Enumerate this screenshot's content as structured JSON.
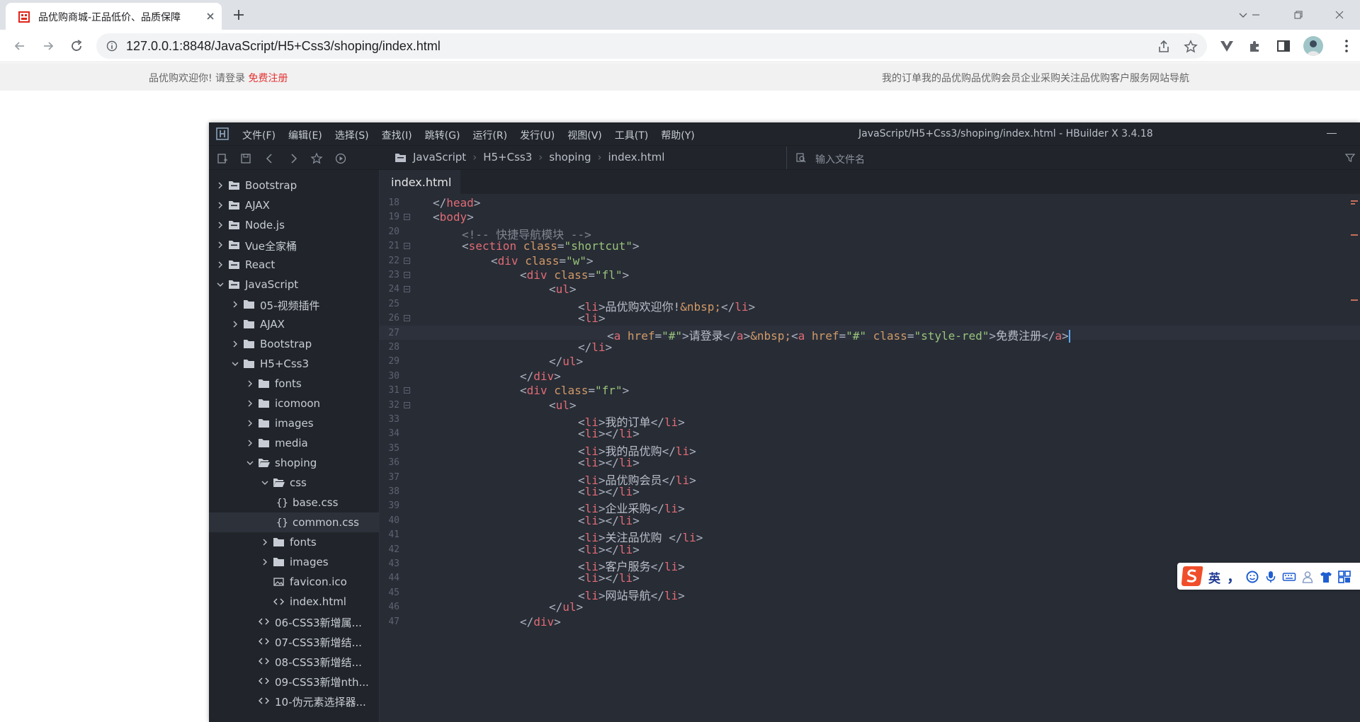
{
  "browser": {
    "tab_title": "品优购商城-正品低价、品质保障",
    "url": "127.0.0.1:8848/JavaScript/H5+Css3/shoping/index.html"
  },
  "page": {
    "shortcut_welcome": "品优购欢迎你! 请登录 ",
    "shortcut_register": "免费注册",
    "shortcut_right": "我的订单我的品优购品优购会员企业采购关注品优购客户服务网站导航"
  },
  "ide": {
    "menu": [
      "文件(F)",
      "编辑(E)",
      "选择(S)",
      "查找(I)",
      "跳转(G)",
      "运行(R)",
      "发行(U)",
      "视图(V)",
      "工具(T)",
      "帮助(Y)"
    ],
    "window_title": "JavaScript/H5+Css3/shoping/index.html - HBuilder X 3.4.18",
    "breadcrumbs": [
      "JavaScript",
      "H5+Css3",
      "shoping",
      "index.html"
    ],
    "file_search_placeholder": "输入文件名",
    "editor_tab": "index.html",
    "tree": [
      {
        "label": "Bootstrap",
        "depth": 0,
        "type": "project",
        "state": "collapsed"
      },
      {
        "label": "AJAX",
        "depth": 0,
        "type": "project",
        "state": "collapsed"
      },
      {
        "label": "Node.js",
        "depth": 0,
        "type": "project",
        "state": "collapsed"
      },
      {
        "label": "Vue全家桶",
        "depth": 0,
        "type": "project",
        "state": "collapsed"
      },
      {
        "label": "React",
        "depth": 0,
        "type": "project",
        "state": "collapsed"
      },
      {
        "label": "JavaScript",
        "depth": 0,
        "type": "project",
        "state": "expanded"
      },
      {
        "label": "05-视频插件",
        "depth": 1,
        "type": "folder",
        "state": "collapsed"
      },
      {
        "label": "AJAX",
        "depth": 1,
        "type": "folder",
        "state": "collapsed"
      },
      {
        "label": "Bootstrap",
        "depth": 1,
        "type": "folder",
        "state": "collapsed"
      },
      {
        "label": "H5+Css3",
        "depth": 1,
        "type": "folder",
        "state": "expanded"
      },
      {
        "label": "fonts",
        "depth": 2,
        "type": "folder",
        "state": "collapsed"
      },
      {
        "label": "icomoon",
        "depth": 2,
        "type": "folder",
        "state": "collapsed"
      },
      {
        "label": "images",
        "depth": 2,
        "type": "folder",
        "state": "collapsed"
      },
      {
        "label": "media",
        "depth": 2,
        "type": "folder",
        "state": "collapsed"
      },
      {
        "label": "shoping",
        "depth": 2,
        "type": "folder-open",
        "state": "expanded"
      },
      {
        "label": "css",
        "depth": 3,
        "type": "folder-open",
        "state": "expanded"
      },
      {
        "label": "base.css",
        "depth": 4,
        "type": "css",
        "state": "none"
      },
      {
        "label": "common.css",
        "depth": 4,
        "type": "css",
        "state": "none",
        "selected": true
      },
      {
        "label": "fonts",
        "depth": 3,
        "type": "folder",
        "state": "collapsed"
      },
      {
        "label": "images",
        "depth": 3,
        "type": "folder",
        "state": "collapsed"
      },
      {
        "label": "favicon.ico",
        "depth": 3,
        "type": "image",
        "state": "none"
      },
      {
        "label": "index.html",
        "depth": 3,
        "type": "html",
        "state": "none"
      },
      {
        "label": "06-CSS3新增属...",
        "depth": 2,
        "type": "html",
        "state": "none"
      },
      {
        "label": "07-CSS3新增结...",
        "depth": 2,
        "type": "html",
        "state": "none"
      },
      {
        "label": "08-CSS3新增结...",
        "depth": 2,
        "type": "html",
        "state": "none"
      },
      {
        "label": "09-CSS3新增nth...",
        "depth": 2,
        "type": "html",
        "state": "none"
      },
      {
        "label": "10-伪元素选择器...",
        "depth": 2,
        "type": "html",
        "state": "none"
      }
    ],
    "code_lines": [
      {
        "n": "18",
        "fold": false,
        "indent": 1,
        "tokens": [
          [
            "p",
            "</"
          ],
          [
            "t",
            "head"
          ],
          [
            "p",
            ">"
          ]
        ]
      },
      {
        "n": "19",
        "fold": true,
        "indent": 1,
        "tokens": [
          [
            "p",
            "<"
          ],
          [
            "t",
            "body"
          ],
          [
            "p",
            ">"
          ]
        ]
      },
      {
        "n": "20",
        "fold": false,
        "indent": 2,
        "tokens": [
          [
            "c",
            "<!-- 快捷导航模块 -->"
          ]
        ]
      },
      {
        "n": "21",
        "fold": true,
        "indent": 2,
        "tokens": [
          [
            "p",
            "<"
          ],
          [
            "t",
            "section"
          ],
          [
            "p",
            " "
          ],
          [
            "a",
            "class"
          ],
          [
            "p",
            "="
          ],
          [
            "s",
            "\"shortcut\""
          ],
          [
            "p",
            ">"
          ]
        ]
      },
      {
        "n": "22",
        "fold": true,
        "indent": 3,
        "tokens": [
          [
            "p",
            "<"
          ],
          [
            "t",
            "div"
          ],
          [
            "p",
            " "
          ],
          [
            "a",
            "class"
          ],
          [
            "p",
            "="
          ],
          [
            "s",
            "\"w\""
          ],
          [
            "p",
            ">"
          ]
        ]
      },
      {
        "n": "23",
        "fold": true,
        "indent": 4,
        "tokens": [
          [
            "p",
            "<"
          ],
          [
            "t",
            "div"
          ],
          [
            "p",
            " "
          ],
          [
            "a",
            "class"
          ],
          [
            "p",
            "="
          ],
          [
            "s",
            "\"fl\""
          ],
          [
            "p",
            ">"
          ]
        ]
      },
      {
        "n": "24",
        "fold": true,
        "indent": 5,
        "tokens": [
          [
            "p",
            "<"
          ],
          [
            "t",
            "ul"
          ],
          [
            "p",
            ">"
          ]
        ]
      },
      {
        "n": "25",
        "fold": false,
        "indent": 6,
        "tokens": [
          [
            "p",
            "<"
          ],
          [
            "t",
            "li"
          ],
          [
            "p",
            ">"
          ],
          [
            "x",
            "品优购欢迎你!"
          ],
          [
            "e",
            "&nbsp;"
          ],
          [
            "p",
            "</"
          ],
          [
            "t",
            "li"
          ],
          [
            "p",
            ">"
          ]
        ]
      },
      {
        "n": "26",
        "fold": true,
        "indent": 6,
        "tokens": [
          [
            "p",
            "<"
          ],
          [
            "t",
            "li"
          ],
          [
            "p",
            ">"
          ]
        ]
      },
      {
        "n": "27",
        "fold": false,
        "indent": 7,
        "current": true,
        "tokens": [
          [
            "p",
            "<"
          ],
          [
            "t",
            "a"
          ],
          [
            "p",
            " "
          ],
          [
            "a",
            "href"
          ],
          [
            "p",
            "="
          ],
          [
            "s",
            "\"#\""
          ],
          [
            "p",
            ">"
          ],
          [
            "x",
            "请登录"
          ],
          [
            "p",
            "</"
          ],
          [
            "t",
            "a"
          ],
          [
            "p",
            ">"
          ],
          [
            "e",
            "&nbsp;"
          ],
          [
            "p",
            "<"
          ],
          [
            "t",
            "a"
          ],
          [
            "p",
            " "
          ],
          [
            "a",
            "href"
          ],
          [
            "p",
            "="
          ],
          [
            "s",
            "\"#\""
          ],
          [
            "p",
            " "
          ],
          [
            "a",
            "class"
          ],
          [
            "p",
            "="
          ],
          [
            "s",
            "\"style-red\""
          ],
          [
            "p",
            ">"
          ],
          [
            "x",
            "免费注册"
          ],
          [
            "p",
            "</"
          ],
          [
            "t",
            "a"
          ],
          [
            "p",
            ">"
          ]
        ]
      },
      {
        "n": "28",
        "fold": false,
        "indent": 6,
        "tokens": [
          [
            "p",
            "</"
          ],
          [
            "t",
            "li"
          ],
          [
            "p",
            ">"
          ]
        ]
      },
      {
        "n": "29",
        "fold": false,
        "indent": 5,
        "tokens": [
          [
            "p",
            "</"
          ],
          [
            "t",
            "ul"
          ],
          [
            "p",
            ">"
          ]
        ]
      },
      {
        "n": "30",
        "fold": false,
        "indent": 4,
        "tokens": [
          [
            "p",
            "</"
          ],
          [
            "t",
            "div"
          ],
          [
            "p",
            ">"
          ]
        ]
      },
      {
        "n": "31",
        "fold": true,
        "indent": 4,
        "tokens": [
          [
            "p",
            "<"
          ],
          [
            "t",
            "div"
          ],
          [
            "p",
            " "
          ],
          [
            "a",
            "class"
          ],
          [
            "p",
            "="
          ],
          [
            "s",
            "\"fr\""
          ],
          [
            "p",
            ">"
          ]
        ]
      },
      {
        "n": "32",
        "fold": true,
        "indent": 5,
        "tokens": [
          [
            "p",
            "<"
          ],
          [
            "t",
            "ul"
          ],
          [
            "p",
            ">"
          ]
        ]
      },
      {
        "n": "33",
        "fold": false,
        "indent": 6,
        "tokens": [
          [
            "p",
            "<"
          ],
          [
            "t",
            "li"
          ],
          [
            "p",
            ">"
          ],
          [
            "x",
            "我的订单"
          ],
          [
            "p",
            "</"
          ],
          [
            "t",
            "li"
          ],
          [
            "p",
            ">"
          ]
        ]
      },
      {
        "n": "34",
        "fold": false,
        "indent": 6,
        "tokens": [
          [
            "p",
            "<"
          ],
          [
            "t",
            "li"
          ],
          [
            "p",
            "></"
          ],
          [
            "t",
            "li"
          ],
          [
            "p",
            ">"
          ]
        ]
      },
      {
        "n": "35",
        "fold": false,
        "indent": 6,
        "tokens": [
          [
            "p",
            "<"
          ],
          [
            "t",
            "li"
          ],
          [
            "p",
            ">"
          ],
          [
            "x",
            "我的品优购"
          ],
          [
            "p",
            "</"
          ],
          [
            "t",
            "li"
          ],
          [
            "p",
            ">"
          ]
        ]
      },
      {
        "n": "36",
        "fold": false,
        "indent": 6,
        "tokens": [
          [
            "p",
            "<"
          ],
          [
            "t",
            "li"
          ],
          [
            "p",
            "></"
          ],
          [
            "t",
            "li"
          ],
          [
            "p",
            ">"
          ]
        ]
      },
      {
        "n": "37",
        "fold": false,
        "indent": 6,
        "tokens": [
          [
            "p",
            "<"
          ],
          [
            "t",
            "li"
          ],
          [
            "p",
            ">"
          ],
          [
            "x",
            "品优购会员"
          ],
          [
            "p",
            "</"
          ],
          [
            "t",
            "li"
          ],
          [
            "p",
            ">"
          ]
        ]
      },
      {
        "n": "38",
        "fold": false,
        "indent": 6,
        "tokens": [
          [
            "p",
            "<"
          ],
          [
            "t",
            "li"
          ],
          [
            "p",
            "></"
          ],
          [
            "t",
            "li"
          ],
          [
            "p",
            ">"
          ]
        ]
      },
      {
        "n": "39",
        "fold": false,
        "indent": 6,
        "tokens": [
          [
            "p",
            "<"
          ],
          [
            "t",
            "li"
          ],
          [
            "p",
            ">"
          ],
          [
            "x",
            "企业采购"
          ],
          [
            "p",
            "</"
          ],
          [
            "t",
            "li"
          ],
          [
            "p",
            ">"
          ]
        ]
      },
      {
        "n": "40",
        "fold": false,
        "indent": 6,
        "tokens": [
          [
            "p",
            "<"
          ],
          [
            "t",
            "li"
          ],
          [
            "p",
            "></"
          ],
          [
            "t",
            "li"
          ],
          [
            "p",
            ">"
          ]
        ]
      },
      {
        "n": "41",
        "fold": false,
        "indent": 6,
        "tokens": [
          [
            "p",
            "<"
          ],
          [
            "t",
            "li"
          ],
          [
            "p",
            ">"
          ],
          [
            "x",
            "关注品优购 "
          ],
          [
            "p",
            "</"
          ],
          [
            "t",
            "li"
          ],
          [
            "p",
            ">"
          ]
        ]
      },
      {
        "n": "42",
        "fold": false,
        "indent": 6,
        "tokens": [
          [
            "p",
            "<"
          ],
          [
            "t",
            "li"
          ],
          [
            "p",
            "></"
          ],
          [
            "t",
            "li"
          ],
          [
            "p",
            ">"
          ]
        ]
      },
      {
        "n": "43",
        "fold": false,
        "indent": 6,
        "tokens": [
          [
            "p",
            "<"
          ],
          [
            "t",
            "li"
          ],
          [
            "p",
            ">"
          ],
          [
            "x",
            "客户服务"
          ],
          [
            "p",
            "</"
          ],
          [
            "t",
            "li"
          ],
          [
            "p",
            ">"
          ]
        ]
      },
      {
        "n": "44",
        "fold": false,
        "indent": 6,
        "tokens": [
          [
            "p",
            "<"
          ],
          [
            "t",
            "li"
          ],
          [
            "p",
            "></"
          ],
          [
            "t",
            "li"
          ],
          [
            "p",
            ">"
          ]
        ]
      },
      {
        "n": "45",
        "fold": false,
        "indent": 6,
        "tokens": [
          [
            "p",
            "<"
          ],
          [
            "t",
            "li"
          ],
          [
            "p",
            ">"
          ],
          [
            "x",
            "网站导航"
          ],
          [
            "p",
            "</"
          ],
          [
            "t",
            "li"
          ],
          [
            "p",
            ">"
          ]
        ]
      },
      {
        "n": "46",
        "fold": false,
        "indent": 5,
        "tokens": [
          [
            "p",
            "</"
          ],
          [
            "t",
            "ul"
          ],
          [
            "p",
            ">"
          ]
        ]
      },
      {
        "n": "47",
        "fold": false,
        "indent": 4,
        "tokens": [
          [
            "p",
            "</"
          ],
          [
            "t",
            "div"
          ],
          [
            "p",
            ">"
          ]
        ]
      }
    ]
  },
  "ime": {
    "lang": "英",
    "punct": "，"
  },
  "colors": {
    "ide_bg": "#282c35",
    "sidebar_bg": "#21252b",
    "tag": "#e06c75",
    "attr": "#d19a66",
    "string": "#98c379",
    "comment": "#7f848e",
    "register_red": "#e33333"
  }
}
